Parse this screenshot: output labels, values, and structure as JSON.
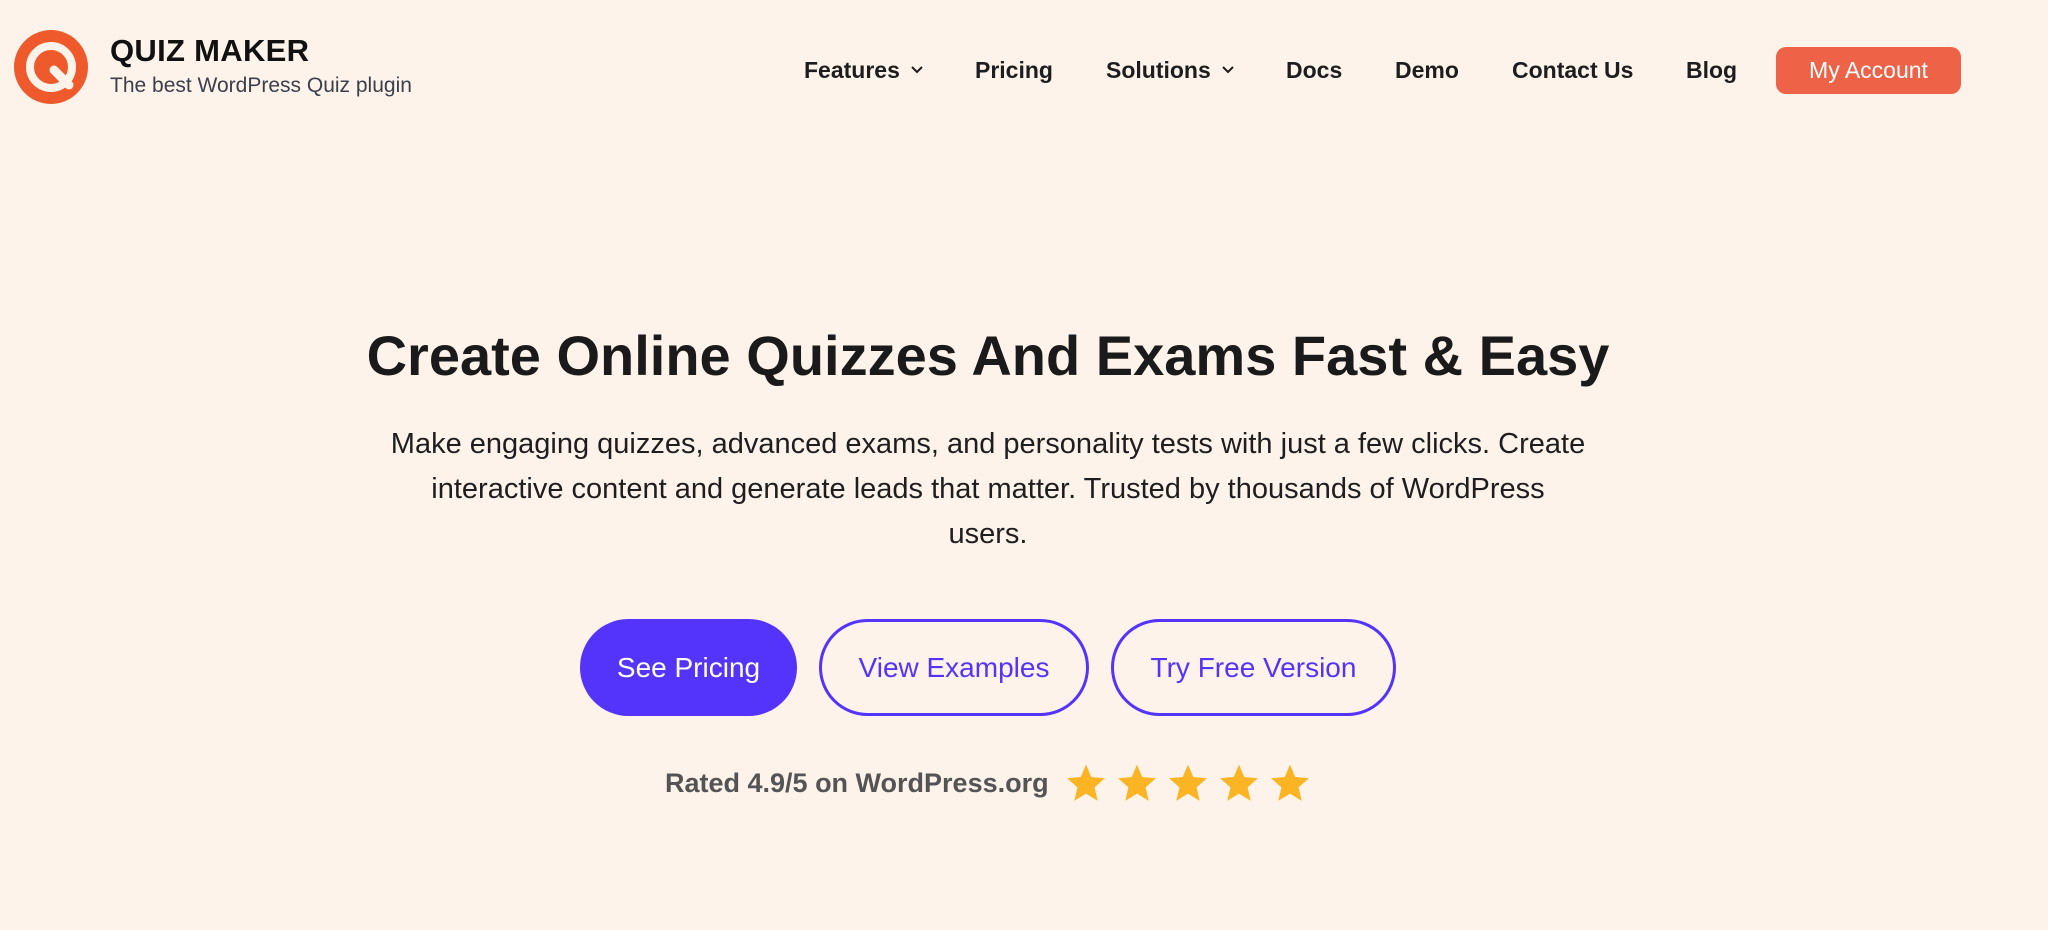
{
  "colors": {
    "background": "#fdf3eb",
    "logo_orange": "#ee5a2b",
    "account_button": "#ee6347",
    "primary": "#5433fb",
    "star": "#fbb524"
  },
  "brand": {
    "logo_icon": "quiz-maker-q-logo",
    "name": "QUIZ MAKER",
    "tagline": "The best WordPress Quiz plugin"
  },
  "nav": {
    "items": [
      {
        "label": "Features",
        "has_dropdown": true,
        "icon": "chevron-down-icon"
      },
      {
        "label": "Pricing",
        "has_dropdown": false
      },
      {
        "label": "Solutions",
        "has_dropdown": true,
        "icon": "chevron-down-icon"
      },
      {
        "label": "Docs",
        "has_dropdown": false
      },
      {
        "label": "Demo",
        "has_dropdown": false
      },
      {
        "label": "Contact Us",
        "has_dropdown": false
      },
      {
        "label": "Blog",
        "has_dropdown": false
      }
    ],
    "account_label": "My Account"
  },
  "hero": {
    "title": "Create Online Quizzes And Exams Fast & Easy",
    "description": "Make engaging quizzes, advanced exams, and personality tests with just a few clicks. Create interactive content and generate leads that matter. Trusted by thousands of WordPress users.",
    "buttons": {
      "pricing_label": "See Pricing",
      "examples_label": "View Examples",
      "free_label": "Try Free Version"
    }
  },
  "rating": {
    "text": "Rated 4.9/5 on WordPress.org",
    "stars_shown": 5,
    "star_icon": "star-icon"
  }
}
